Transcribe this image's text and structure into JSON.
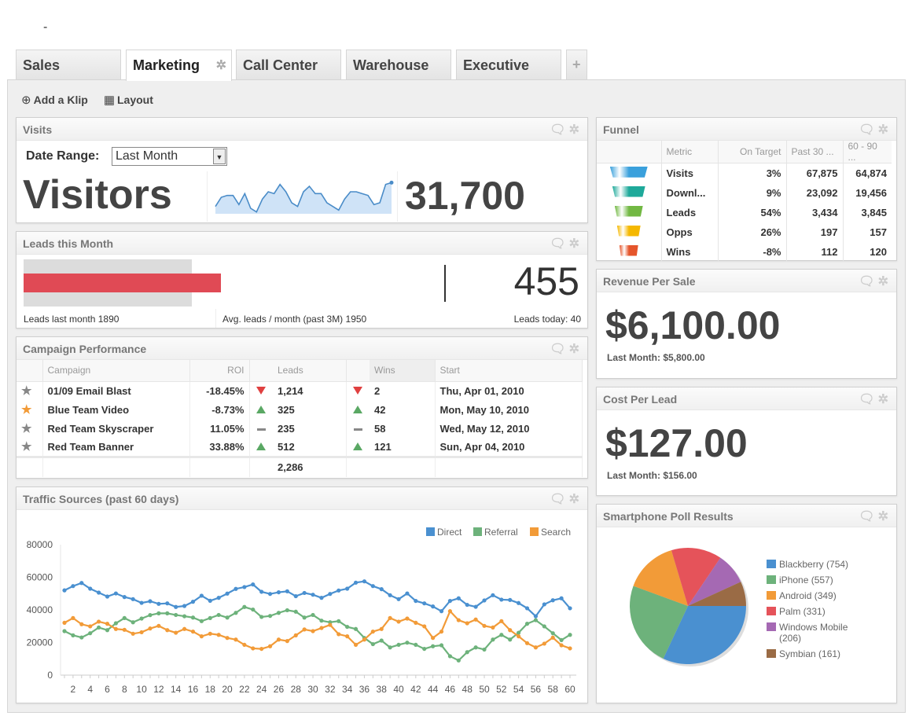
{
  "header": {
    "dash": "-"
  },
  "tabs": [
    {
      "label": "Sales"
    },
    {
      "label": "Marketing",
      "active": true
    },
    {
      "label": "Call Center"
    },
    {
      "label": "Warehouse"
    },
    {
      "label": "Executive"
    },
    {
      "label": "+"
    }
  ],
  "toolbar": {
    "add_klip": "Add a Klip",
    "layout": "Layout"
  },
  "visits": {
    "title": "Visits",
    "date_range_label": "Date Range:",
    "date_range_value": "Last Month",
    "label": "Visitors",
    "value": "31,700",
    "sparkline": [
      20,
      45,
      50,
      50,
      25,
      55,
      15,
      5,
      40,
      60,
      55,
      80,
      60,
      30,
      20,
      60,
      75,
      55,
      55,
      30,
      20,
      10,
      40,
      60,
      60,
      55,
      50,
      25,
      30,
      80,
      85
    ]
  },
  "leads": {
    "title": "Leads this Month",
    "value": "455",
    "last_month": "Leads last month 1890",
    "avg": "Avg. leads / month (past 3M) 1950",
    "today": "Leads today: 40",
    "bar_value": 455,
    "bar_target": 1950,
    "bar_color": "#e04a55"
  },
  "campaign": {
    "title": "Campaign Performance",
    "headers": [
      "Campaign",
      "ROI",
      "Leads",
      "Wins",
      "Start"
    ],
    "rows": [
      {
        "starred": false,
        "name": "01/09 Email Blast",
        "roi": "-18.45%",
        "leads_trend": "down",
        "leads": "1,214",
        "wins_trend": "down",
        "wins": "2",
        "start": "Thu, Apr 01, 2010"
      },
      {
        "starred": true,
        "name": "Blue Team Video",
        "roi": "-8.73%",
        "leads_trend": "up",
        "leads": "325",
        "wins_trend": "up",
        "wins": "42",
        "start": "Mon, May 10, 2010"
      },
      {
        "starred": false,
        "name": "Red Team Skyscraper",
        "roi": "11.05%",
        "leads_trend": "flat",
        "leads": "235",
        "wins_trend": "flat",
        "wins": "58",
        "start": "Wed, May 12, 2010"
      },
      {
        "starred": false,
        "name": "Red Team Banner",
        "roi": "33.88%",
        "leads_trend": "up",
        "leads": "512",
        "wins_trend": "up",
        "wins": "121",
        "start": "Sun, Apr 04, 2010"
      }
    ],
    "total_leads": "2,286"
  },
  "funnel": {
    "title": "Funnel",
    "headers": [
      "Metric",
      "On Target",
      "Past 30 ...",
      "60 - 90 ..."
    ],
    "rows": [
      {
        "metric": "Visits",
        "on_target": "3%",
        "past30": "67,875",
        "p6090": "64,874",
        "color": "#3aa0dc"
      },
      {
        "metric": "Downl...",
        "on_target": "9%",
        "past30": "23,092",
        "p6090": "19,456",
        "color": "#1ea99a"
      },
      {
        "metric": "Leads",
        "on_target": "54%",
        "past30": "3,434",
        "p6090": "3,845",
        "color": "#72b843"
      },
      {
        "metric": "Opps",
        "on_target": "26%",
        "past30": "197",
        "p6090": "157",
        "color": "#f5b800"
      },
      {
        "metric": "Wins",
        "on_target": "-8%",
        "past30": "112",
        "p6090": "120",
        "color": "#e5552b"
      }
    ]
  },
  "revenue": {
    "title": "Revenue Per Sale",
    "value": "$6,100.00",
    "last": "Last Month: $5,800.00"
  },
  "cost": {
    "title": "Cost Per Lead",
    "value": "$127.00",
    "last": "Last Month: $156.00"
  },
  "chart_data": [
    {
      "title": "Traffic Sources (past 60 days)",
      "type": "line",
      "ylim": [
        0,
        80000
      ],
      "yticks": [
        0,
        20000,
        40000,
        60000,
        80000
      ],
      "legend": "top-right",
      "x": [
        1,
        2,
        3,
        4,
        5,
        6,
        7,
        8,
        9,
        10,
        11,
        12,
        13,
        14,
        15,
        16,
        17,
        18,
        19,
        20,
        21,
        22,
        23,
        24,
        25,
        26,
        27,
        28,
        29,
        30,
        31,
        32,
        33,
        34,
        35,
        36,
        37,
        38,
        39,
        40,
        41,
        42,
        43,
        44,
        45,
        46,
        47,
        48,
        49,
        50,
        51,
        52,
        53,
        54,
        55,
        56,
        57,
        58,
        59,
        60
      ],
      "series": [
        {
          "name": "Direct",
          "color": "#4a90d0",
          "values": [
            52000,
            54600,
            56500,
            53000,
            50600,
            48200,
            50100,
            47900,
            46600,
            44300,
            45300,
            43700,
            44000,
            41800,
            42400,
            45000,
            48700,
            45600,
            47400,
            50000,
            52900,
            54000,
            55600,
            51100,
            49800,
            50800,
            51400,
            48400,
            50400,
            49300,
            47400,
            49800,
            51900,
            53000,
            56700,
            57500,
            54600,
            52700,
            49000,
            46600,
            50100,
            45500,
            44000,
            42100,
            39200,
            45500,
            47100,
            43100,
            41900,
            45800,
            49000,
            46300,
            46100,
            44200,
            41000,
            36100,
            43400,
            45900,
            47100,
            41000
          ]
        },
        {
          "name": "Referral",
          "color": "#6db27b",
          "values": [
            27000,
            24400,
            23100,
            25700,
            29200,
            27600,
            31800,
            35000,
            32400,
            34700,
            36800,
            37900,
            37900,
            36900,
            36100,
            35300,
            33100,
            35000,
            36900,
            35300,
            38200,
            41800,
            40200,
            35700,
            36300,
            38200,
            39800,
            38900,
            35300,
            36900,
            33400,
            32400,
            33100,
            29600,
            28300,
            22800,
            19000,
            21200,
            17000,
            18600,
            19900,
            18600,
            16100,
            17700,
            18300,
            11600,
            9000,
            14100,
            17000,
            15700,
            21800,
            24700,
            21800,
            26000,
            31500,
            33700,
            29900,
            25700,
            21500,
            24700
          ]
        },
        {
          "name": "Search",
          "color": "#f29b38",
          "values": [
            32100,
            35000,
            31200,
            29900,
            32800,
            31500,
            28300,
            27800,
            25400,
            26300,
            28600,
            30200,
            27600,
            26000,
            28300,
            26700,
            23800,
            25400,
            24700,
            22800,
            21800,
            18600,
            16400,
            16100,
            17700,
            21800,
            20900,
            24400,
            28000,
            27000,
            28900,
            30800,
            25100,
            23800,
            18600,
            21800,
            26700,
            28300,
            35000,
            32800,
            34700,
            32100,
            29900,
            22800,
            26700,
            39200,
            33700,
            31800,
            34100,
            30200,
            29200,
            33100,
            27600,
            23800,
            19600,
            17000,
            19300,
            23000,
            18300,
            16400
          ]
        }
      ]
    },
    {
      "title": "Smartphone Poll Results",
      "type": "pie",
      "slices": [
        {
          "label": "Blackberry (754)",
          "name": "Blackberry",
          "value": 754,
          "color": "#4a90d0"
        },
        {
          "label": "iPhone (557)",
          "name": "iPhone",
          "value": 557,
          "color": "#6db27b"
        },
        {
          "label": "Android (349)",
          "name": "Android",
          "value": 349,
          "color": "#f29b38"
        },
        {
          "label": "Palm (331)",
          "name": "Palm",
          "value": 331,
          "color": "#e5535a"
        },
        {
          "label": "Windows Mobile (206)",
          "name": "Windows Mobile",
          "value": 206,
          "color": "#a569b3"
        },
        {
          "label": "Symbian (161)",
          "name": "Symbian",
          "value": 161,
          "color": "#9a6b45"
        }
      ]
    }
  ]
}
